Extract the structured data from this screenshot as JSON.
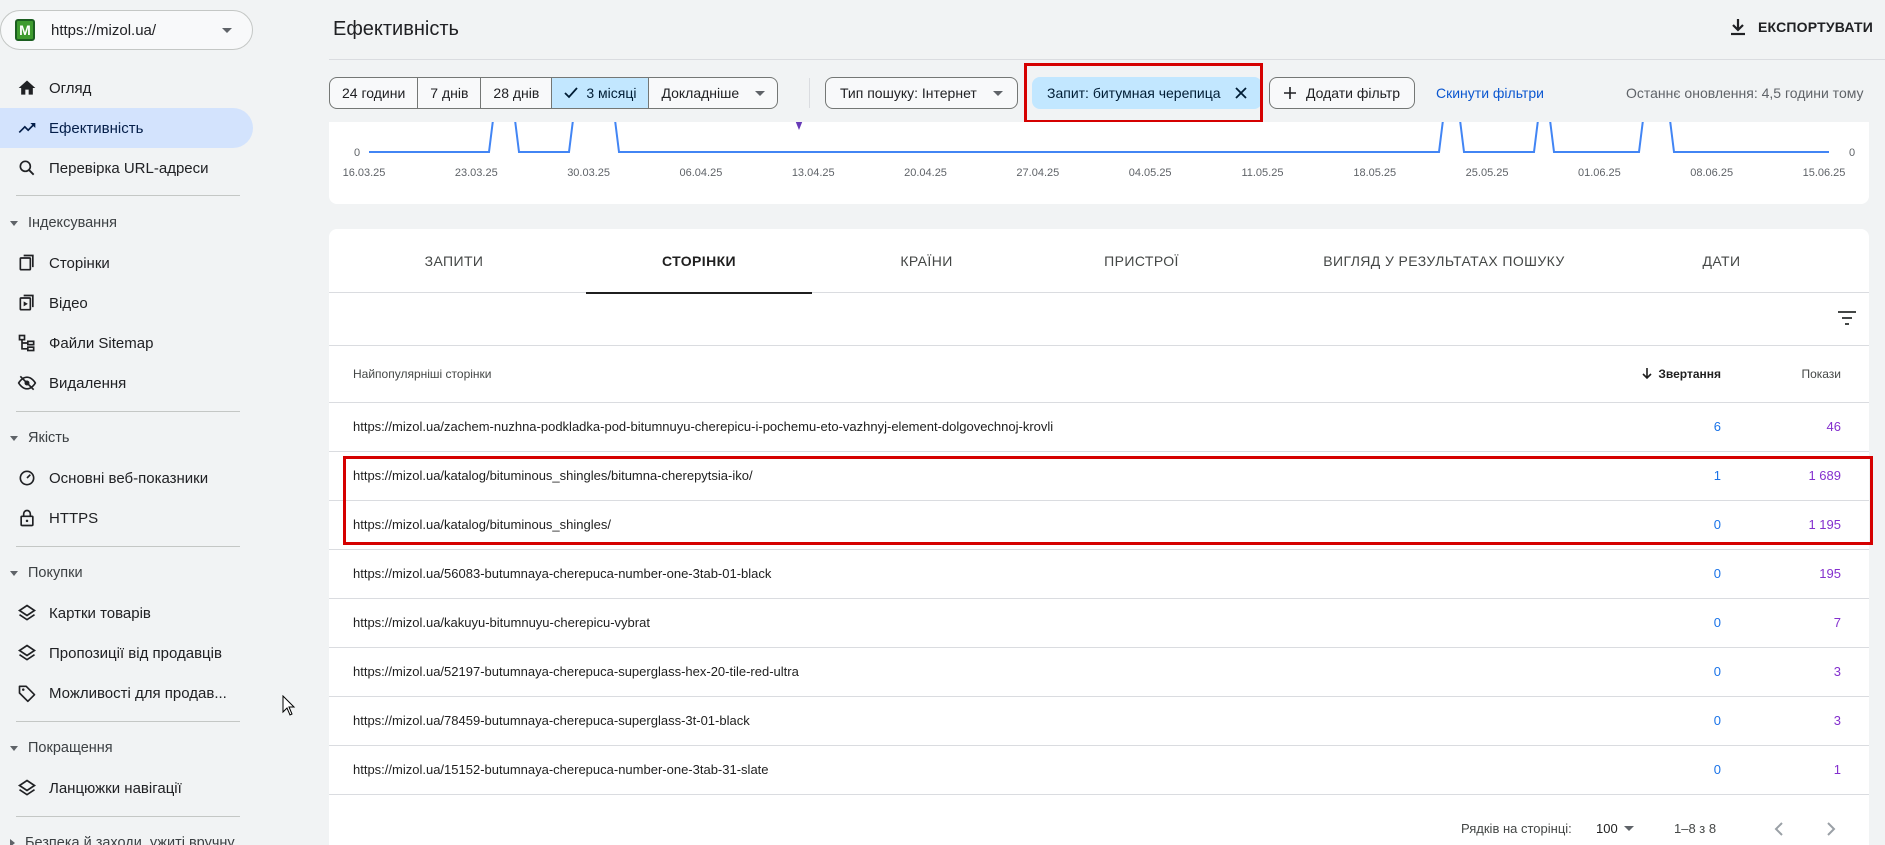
{
  "property": {
    "url": "https://mizol.ua/",
    "logo_letter": "M"
  },
  "sidebar": {
    "items": [
      {
        "label": "Огляд",
        "icon": "home-icon"
      },
      {
        "label": "Ефективність",
        "icon": "trending-up-icon",
        "active": true
      },
      {
        "label": "Перевірка URL-адреси",
        "icon": "search-icon"
      }
    ],
    "sections": [
      {
        "title": "Індексування",
        "items": [
          {
            "label": "Сторінки",
            "icon": "pages-icon"
          },
          {
            "label": "Відео",
            "icon": "video-pages-icon"
          },
          {
            "label": "Файли Sitemap",
            "icon": "sitemap-icon"
          },
          {
            "label": "Видалення",
            "icon": "removals-icon"
          }
        ]
      },
      {
        "title": "Якість",
        "items": [
          {
            "label": "Основні веб-показники",
            "icon": "speed-icon"
          },
          {
            "label": "HTTPS",
            "icon": "lock-icon"
          }
        ]
      },
      {
        "title": "Покупки",
        "items": [
          {
            "label": "Картки товарів",
            "icon": "layers-icon"
          },
          {
            "label": "Пропозиції від продавців",
            "icon": "layers-icon"
          },
          {
            "label": "Можливості для продав...",
            "icon": "tag-icon"
          }
        ]
      },
      {
        "title": "Покращення",
        "items": [
          {
            "label": "Ланцюжки навігації",
            "icon": "layers-icon"
          }
        ]
      },
      {
        "title": "Безпека й заходи, ужиті вручну",
        "items": []
      }
    ]
  },
  "header": {
    "title": "Ефективність",
    "export_label": "ЕКСПОРТУВАТИ"
  },
  "toolbar": {
    "date_ranges": [
      "24 години",
      "7 днів",
      "28 днів",
      "3 місяці",
      "Докладніше"
    ],
    "active_range": "3 місяці",
    "search_type": "Тип пошуку: Інтернет",
    "query_filter": "Запит: битумная черепица",
    "add_filter": "Додати фільтр",
    "reset_filters": "Скинути фільтри",
    "last_update": "Останнє оновлення: 4,5 години тому"
  },
  "chart_data": {
    "type": "line",
    "x": [
      "16.03.25",
      "23.03.25",
      "30.03.25",
      "06.04.25",
      "13.04.25",
      "20.04.25",
      "27.04.25",
      "04.05.25",
      "11.05.25",
      "18.05.25",
      "25.05.25",
      "01.06.25",
      "08.06.25",
      "15.06.25"
    ],
    "y_left_tick": "0",
    "y_right_tick": "0",
    "accent_color": "#4285f4"
  },
  "tabs": [
    "ЗАПИТИ",
    "СТОРІНКИ",
    "КРАЇНИ",
    "ПРИСТРОЇ",
    "ВИГЛЯД У РЕЗУЛЬТАТАХ ПОШУКУ",
    "ДАТИ"
  ],
  "active_tab": "СТОРІНКИ",
  "table": {
    "headers": {
      "pages": "Найпопулярніші сторінки",
      "clicks": "Звертання",
      "impressions": "Покази"
    },
    "rows": [
      {
        "url": "https://mizol.ua/zachem-nuzhna-podkladka-pod-bitumnuyu-cherepicu-i-pochemu-eto-vazhnyj-element-dolgovechnoj-krovli",
        "clicks": "6",
        "impressions": "46"
      },
      {
        "url": "https://mizol.ua/katalog/bituminous_shingles/bitumna-cherepytsia-iko/",
        "clicks": "1",
        "impressions": "1 689"
      },
      {
        "url": "https://mizol.ua/katalog/bituminous_shingles/",
        "clicks": "0",
        "impressions": "1 195"
      },
      {
        "url": "https://mizol.ua/56083-butumnaya-cherepuca-number-one-3tab-01-black",
        "clicks": "0",
        "impressions": "195"
      },
      {
        "url": "https://mizol.ua/kakuyu-bitumnuyu-cherepicu-vybrat",
        "clicks": "0",
        "impressions": "7"
      },
      {
        "url": "https://mizol.ua/52197-butumnaya-cherepuca-superglass-hex-20-tile-red-ultra",
        "clicks": "0",
        "impressions": "3"
      },
      {
        "url": "https://mizol.ua/78459-butumnaya-cherepuca-superglass-3t-01-black",
        "clicks": "0",
        "impressions": "3"
      },
      {
        "url": "https://mizol.ua/15152-butumnaya-cherepuca-number-one-3tab-31-slate",
        "clicks": "0",
        "impressions": "1"
      }
    ]
  },
  "pagination": {
    "rows_label": "Рядків на сторінці:",
    "rows_value": "100",
    "range": "1–8 з 8"
  }
}
